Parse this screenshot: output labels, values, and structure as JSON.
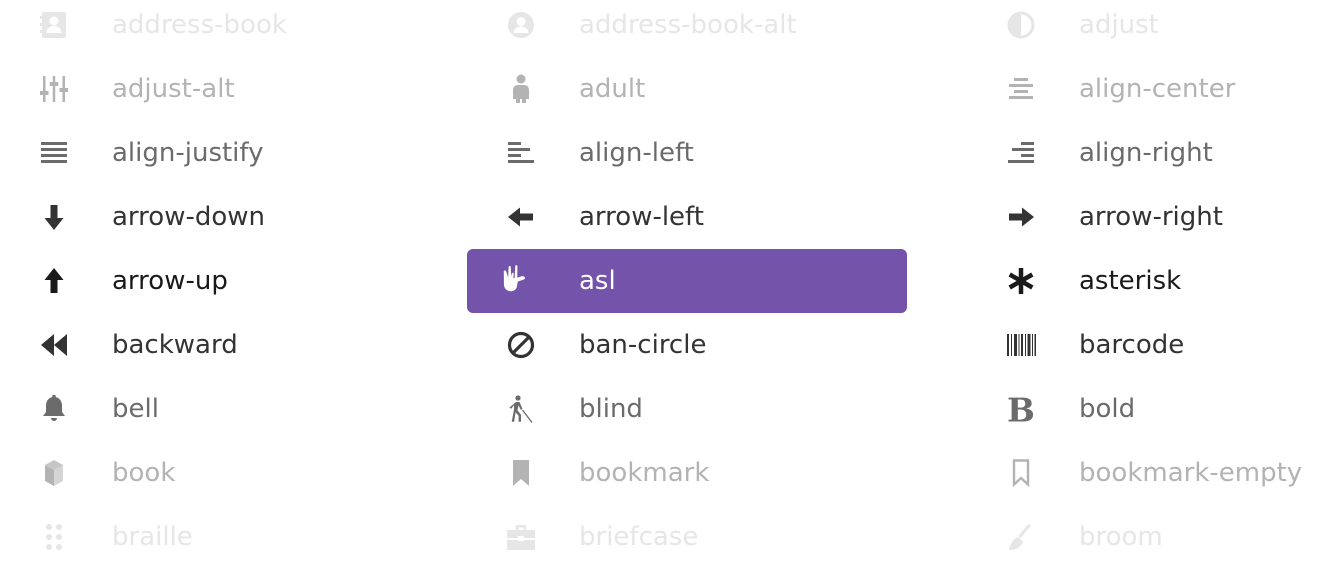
{
  "icon_grid": {
    "selected_color": "#7453ab",
    "items": [
      {
        "id": "address-book",
        "label": "address-book",
        "icon": "address-book-icon",
        "color": "#e6e6e6"
      },
      {
        "id": "address-book-alt",
        "label": "address-book-alt",
        "icon": "address-book-alt-icon",
        "color": "#e6e6e6"
      },
      {
        "id": "adjust",
        "label": "adjust",
        "icon": "adjust-icon",
        "color": "#e6e6e6"
      },
      {
        "id": "adjust-alt",
        "label": "adjust-alt",
        "icon": "adjust-alt-icon",
        "color": "#b3b3b3"
      },
      {
        "id": "adult",
        "label": "adult",
        "icon": "adult-icon",
        "color": "#b3b3b3"
      },
      {
        "id": "align-center",
        "label": "align-center",
        "icon": "align-center-icon",
        "color": "#b3b3b3"
      },
      {
        "id": "align-justify",
        "label": "align-justify",
        "icon": "align-justify-icon",
        "color": "#6b6b6b"
      },
      {
        "id": "align-left",
        "label": "align-left",
        "icon": "align-left-icon",
        "color": "#6b6b6b"
      },
      {
        "id": "align-right",
        "label": "align-right",
        "icon": "align-right-icon",
        "color": "#6b6b6b"
      },
      {
        "id": "arrow-down",
        "label": "arrow-down",
        "icon": "arrow-down-icon",
        "color": "#333333"
      },
      {
        "id": "arrow-left",
        "label": "arrow-left",
        "icon": "arrow-left-icon",
        "color": "#333333"
      },
      {
        "id": "arrow-right",
        "label": "arrow-right",
        "icon": "arrow-right-icon",
        "color": "#333333"
      },
      {
        "id": "arrow-up",
        "label": "arrow-up",
        "icon": "arrow-up-icon",
        "color": "#1a1a1a"
      },
      {
        "id": "asl",
        "label": "asl",
        "icon": "asl-hand-icon",
        "color": "#ffffff",
        "selected": true
      },
      {
        "id": "asterisk",
        "label": "asterisk",
        "icon": "asterisk-icon",
        "color": "#1a1a1a"
      },
      {
        "id": "backward",
        "label": "backward",
        "icon": "backward-icon",
        "color": "#333333"
      },
      {
        "id": "ban-circle",
        "label": "ban-circle",
        "icon": "ban-circle-icon",
        "color": "#333333"
      },
      {
        "id": "barcode",
        "label": "barcode",
        "icon": "barcode-icon",
        "color": "#333333"
      },
      {
        "id": "bell",
        "label": "bell",
        "icon": "bell-icon",
        "color": "#6b6b6b"
      },
      {
        "id": "blind",
        "label": "blind",
        "icon": "blind-icon",
        "color": "#6b6b6b"
      },
      {
        "id": "bold",
        "label": "bold",
        "icon": "bold-icon",
        "color": "#6b6b6b"
      },
      {
        "id": "book",
        "label": "book",
        "icon": "book-icon",
        "color": "#b3b3b3"
      },
      {
        "id": "bookmark",
        "label": "bookmark",
        "icon": "bookmark-icon",
        "color": "#b3b3b3"
      },
      {
        "id": "bookmark-empty",
        "label": "bookmark-empty",
        "icon": "bookmark-empty-icon",
        "color": "#b3b3b3"
      },
      {
        "id": "braille",
        "label": "braille",
        "icon": "braille-icon",
        "color": "#e6e6e6"
      },
      {
        "id": "briefcase",
        "label": "briefcase",
        "icon": "briefcase-icon",
        "color": "#e6e6e6"
      },
      {
        "id": "broom",
        "label": "broom",
        "icon": "broom-icon",
        "color": "#e6e6e6"
      }
    ]
  }
}
